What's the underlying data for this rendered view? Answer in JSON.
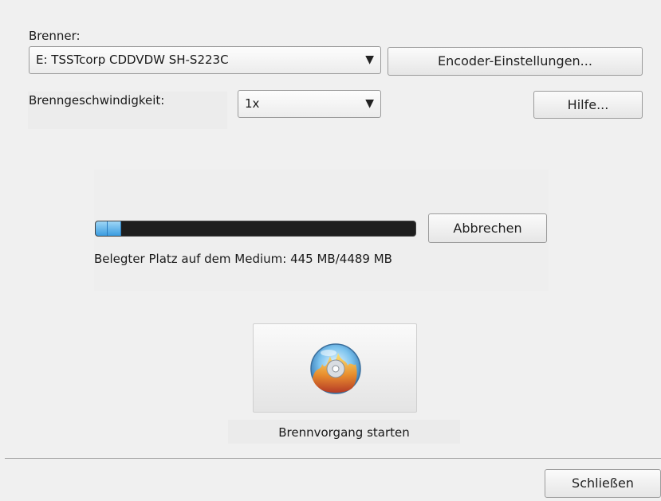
{
  "burner": {
    "label": "Brenner:",
    "selected_drive": "E: TSSTcorp CDDVDW SH-S223C",
    "encoder_settings_button": "Encoder-Einstellungen..."
  },
  "speed": {
    "label": "Brenngeschwindigkeit:",
    "selected": "1x",
    "help_button": "Hilfe..."
  },
  "progress": {
    "used_mb": 445,
    "total_mb": 4489,
    "fill_fraction": 0.077,
    "cancel_button": "Abbrechen",
    "status_text": "Belegter Platz auf dem Medium: 445 MB/4489 MB"
  },
  "burn": {
    "icon": "burn-disc-flame-icon",
    "caption": "Brennvorgang starten"
  },
  "footer": {
    "close_button": "Schließen"
  },
  "icons": {
    "dropdown": "chevron-down-icon",
    "dropdown_glyph": "▼"
  },
  "colors": {
    "progress_fill": "#3a9ce0",
    "progress_track": "#1e1e1e",
    "panel_background": "#f0f0f0"
  }
}
